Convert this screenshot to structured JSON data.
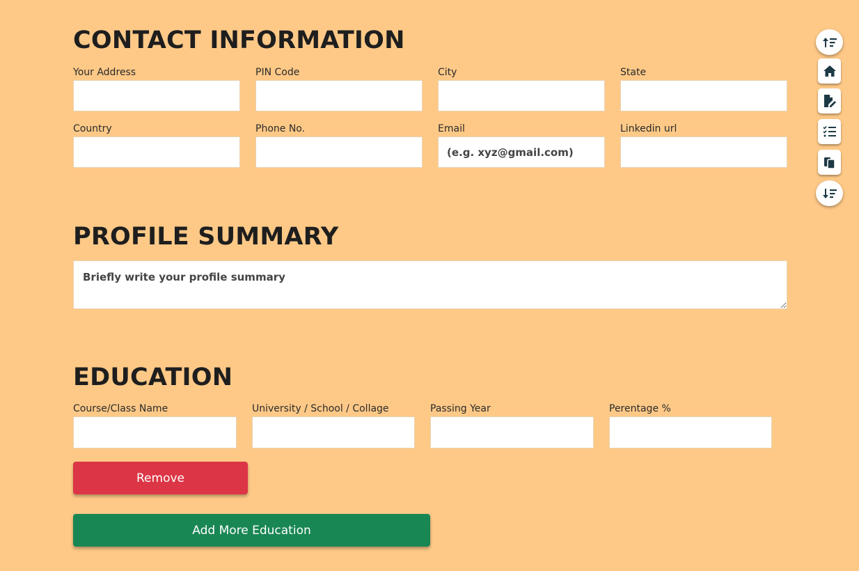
{
  "contact": {
    "title": "CONTACT INFORMATION",
    "fields": [
      {
        "label": "Your Address",
        "value": "",
        "placeholder": ""
      },
      {
        "label": "PIN Code",
        "value": "",
        "placeholder": ""
      },
      {
        "label": "City",
        "value": "",
        "placeholder": ""
      },
      {
        "label": "State",
        "value": "",
        "placeholder": ""
      },
      {
        "label": "Country",
        "value": "",
        "placeholder": ""
      },
      {
        "label": "Phone No.",
        "value": "",
        "placeholder": ""
      },
      {
        "label": "Email",
        "value": "",
        "placeholder": "(e.g. xyz@gmail.com)"
      },
      {
        "label": "Linkedin url",
        "value": "",
        "placeholder": ""
      }
    ]
  },
  "summary": {
    "title": "PROFILE SUMMARY",
    "placeholder": "Briefly write your profile summary"
  },
  "education": {
    "title": "EDUCATION",
    "fields": [
      {
        "label": "Course/Class Name",
        "value": ""
      },
      {
        "label": "University / School / Collage",
        "value": ""
      },
      {
        "label": "Passing Year",
        "value": ""
      },
      {
        "label": "Perentage %",
        "value": ""
      }
    ],
    "remove_label": "Remove",
    "add_label": "Add More Education"
  },
  "sidenav": {
    "icons": [
      "sort-up-icon",
      "home-icon",
      "file-edit-icon",
      "list-check-icon",
      "copy-icon",
      "sort-down-icon"
    ]
  },
  "colors": {
    "background": "#fec987",
    "remove": "#dc3545",
    "add": "#198754",
    "nav_icon": "#1d3a44"
  }
}
